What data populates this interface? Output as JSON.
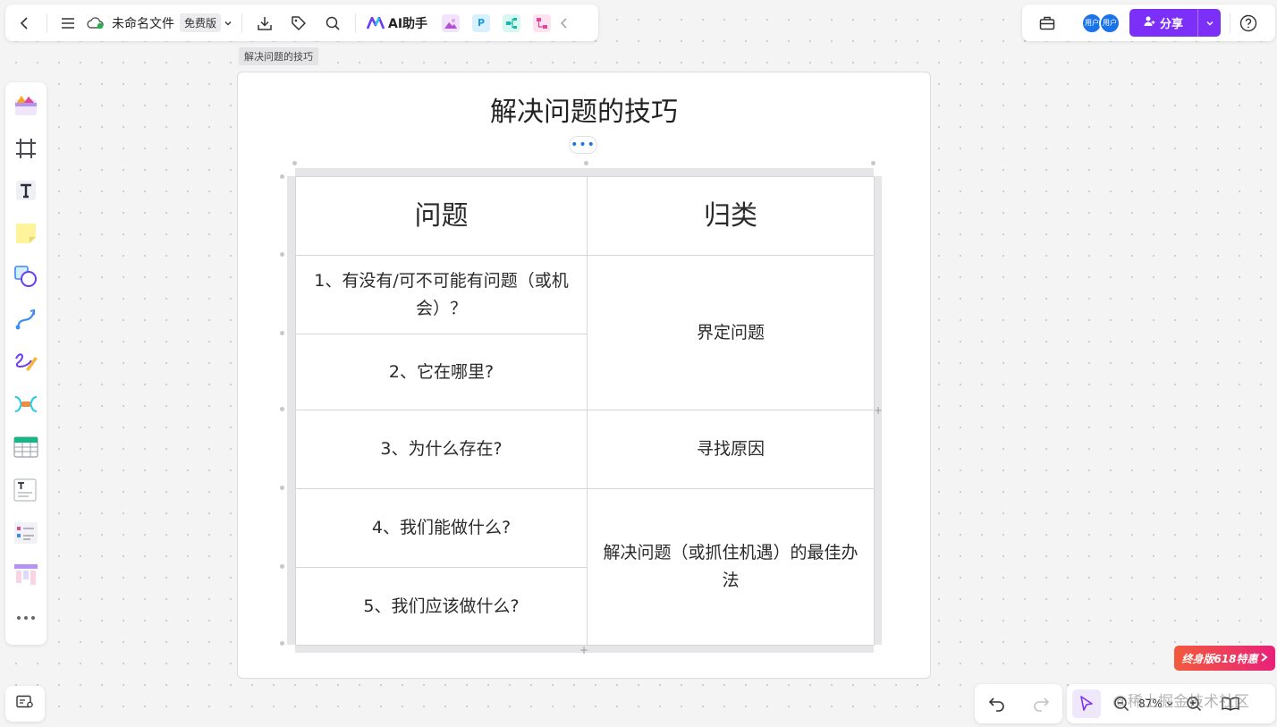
{
  "topbar": {
    "file_name": "未命名文件",
    "plan_badge": "免费版",
    "ai_label": "AI助手",
    "plugins": [
      {
        "icon": "image-plugin-icon",
        "color": "#b44fd8"
      },
      {
        "icon": "p-plugin-icon",
        "color": "#1b98e0",
        "letter": "P"
      },
      {
        "icon": "mindmap-plugin-icon",
        "color": "#19b7a7"
      },
      {
        "icon": "flow-plugin-icon",
        "color": "#e0489a"
      }
    ]
  },
  "topright": {
    "avatars": [
      "用户",
      "用户"
    ],
    "share_label": "分享",
    "accent": "#7b2ff7"
  },
  "sidebar": {
    "tools": [
      "templates-icon",
      "frame-icon",
      "text-icon",
      "sticky-note-icon",
      "shape-icon",
      "connector-icon",
      "pen-icon",
      "mindmap-icon",
      "table-icon",
      "text-card-icon",
      "list-card-icon",
      "kanban-icon",
      "more-icon"
    ]
  },
  "canvas": {
    "frame_label": "解决问题的技巧",
    "title": "解决问题的技巧",
    "more_dots": "•••",
    "table": {
      "headers": [
        "问题",
        "归类"
      ],
      "questions": [
        "1、有没有/可不可能有问题（或机会）？",
        "2、它在哪里?",
        "3、为什么存在?",
        "4、我们能做什么?",
        "5、我们应该做什么?"
      ],
      "categories": [
        "界定问题",
        "寻找原因",
        "解决问题（或抓住机遇）的最佳办法"
      ]
    }
  },
  "bottom": {
    "zoom": "87%",
    "promo": "终身版618特惠",
    "watermark": "@稀土掘金技术社区"
  }
}
